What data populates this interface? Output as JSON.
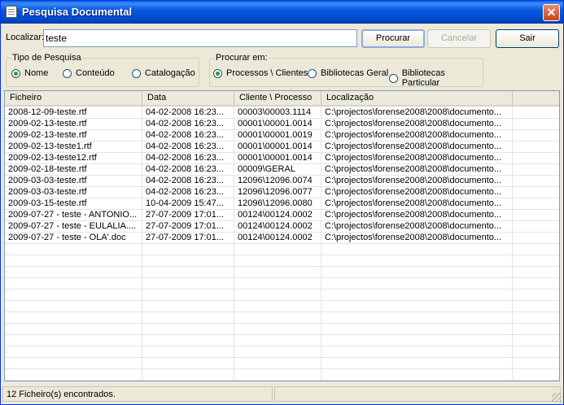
{
  "window": {
    "title": "Pesquisa Documental",
    "close_glyph": "✕"
  },
  "search": {
    "label": "Localizar:",
    "value": "teste"
  },
  "buttons": {
    "search": "Procurar",
    "cancel": "Cancelar",
    "exit": "Sair"
  },
  "search_type": {
    "legend": "Tipo de Pesquisa",
    "options": [
      "Nome",
      "Conteúdo",
      "Catalogação"
    ],
    "selected": "Nome"
  },
  "search_in": {
    "legend": "Procurar em:",
    "options": [
      "Processos \\ Clientes",
      "Bibliotecas Geral",
      "Bibliotecas Particular"
    ],
    "selected": "Processos \\ Clientes"
  },
  "table": {
    "columns": [
      "Ficheiro",
      "Data",
      "Cliente \\ Processo",
      "Localização"
    ],
    "rows": [
      [
        "2008-12-09-teste.rtf",
        "04-02-2008 16:23...",
        "00003\\00003.1114",
        "C:\\projectos\\forense2008\\2008\\documento..."
      ],
      [
        "2009-02-13-teste.rtf",
        "04-02-2008 16:23...",
        "00001\\00001.0014",
        "C:\\projectos\\forense2008\\2008\\documento..."
      ],
      [
        "2009-02-13-teste.rtf",
        "04-02-2008 16:23...",
        "00001\\00001.0019",
        "C:\\projectos\\forense2008\\2008\\documento..."
      ],
      [
        "2009-02-13-teste1.rtf",
        "04-02-2008 16:23...",
        "00001\\00001.0014",
        "C:\\projectos\\forense2008\\2008\\documento..."
      ],
      [
        "2009-02-13-teste12.rtf",
        "04-02-2008 16:23...",
        "00001\\00001.0014",
        "C:\\projectos\\forense2008\\2008\\documento..."
      ],
      [
        "2009-02-18-teste.rtf",
        "04-02-2008 16:23...",
        "00009\\GERAL",
        "C:\\projectos\\forense2008\\2008\\documento..."
      ],
      [
        "2009-03-03-teste.rtf",
        "04-02-2008 16:23...",
        "12096\\12096.0074",
        "C:\\projectos\\forense2008\\2008\\documento..."
      ],
      [
        "2009-03-03-teste.rtf",
        "04-02-2008 16:23...",
        "12096\\12096.0077",
        "C:\\projectos\\forense2008\\2008\\documento..."
      ],
      [
        "2009-03-15-teste.rtf",
        "10-04-2009 15:47...",
        "12096\\12096.0080",
        "C:\\projectos\\forense2008\\2008\\documento..."
      ],
      [
        "2009-07-27 - teste - ANTONIO...",
        "27-07-2009 17:01...",
        "00124\\00124.0002",
        "C:\\projectos\\forense2008\\2008\\documento..."
      ],
      [
        "2009-07-27 - teste - EULALIA....",
        "27-07-2009 17:01...",
        "00124\\00124.0002",
        "C:\\projectos\\forense2008\\2008\\documento..."
      ],
      [
        "2009-07-27 - teste - OLA'.doc",
        "27-07-2009 17:01...",
        "00124\\00124.0002",
        "C:\\projectos\\forense2008\\2008\\documento..."
      ]
    ]
  },
  "status": {
    "text": "12 Ficheiro(s) encontrados."
  }
}
